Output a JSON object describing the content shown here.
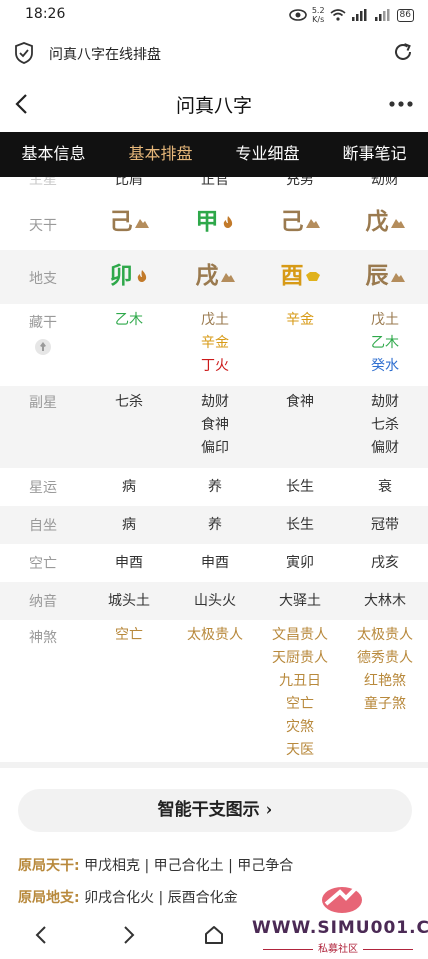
{
  "status": {
    "time": "18:26",
    "netspeed_value": "5.2",
    "netspeed_unit": "K/s",
    "battery": "86"
  },
  "browser": {
    "page_title": "问真八字在线排盘"
  },
  "app": {
    "title": "问真八字"
  },
  "tabs": [
    {
      "label": "基本信息",
      "active": false
    },
    {
      "label": "基本排盘",
      "active": true
    },
    {
      "label": "专业细盘",
      "active": false
    },
    {
      "label": "断事笔记",
      "active": false
    }
  ],
  "chart": {
    "main_star": {
      "label": "主星",
      "values": [
        "比肩",
        "正官",
        "充男",
        "劫财"
      ]
    },
    "heavenly_stems": {
      "label": "天干",
      "values": [
        "己",
        "甲",
        "己",
        "戊"
      ]
    },
    "earthly_branches": {
      "label": "地支",
      "values": [
        "卯",
        "戌",
        "酉",
        "辰"
      ]
    },
    "hidden_stems": {
      "label": "藏干",
      "values": [
        [
          "乙木"
        ],
        [
          "戊土",
          "辛金",
          "丁火"
        ],
        [
          "辛金"
        ],
        [
          "戊土",
          "乙木",
          "癸水"
        ]
      ]
    },
    "sub_star": {
      "label": "副星",
      "values": [
        [
          "七杀"
        ],
        [
          "劫财",
          "食神",
          "偏印"
        ],
        [
          "食神"
        ],
        [
          "劫财",
          "七杀",
          "偏财"
        ]
      ]
    },
    "star_luck": {
      "label": "星运",
      "values": [
        "病",
        "养",
        "长生",
        "衰"
      ]
    },
    "self_seat": {
      "label": "自坐",
      "values": [
        "病",
        "养",
        "长生",
        "冠带"
      ]
    },
    "void": {
      "label": "空亡",
      "values": [
        "申酉",
        "申酉",
        "寅卯",
        "戌亥"
      ]
    },
    "nayin": {
      "label": "纳音",
      "values": [
        "城头土",
        "山头火",
        "大驿土",
        "大林木"
      ]
    },
    "shensha": {
      "label": "神煞",
      "values": [
        [
          "空亡"
        ],
        [
          "太极贵人"
        ],
        [
          "文昌贵人",
          "天厨贵人",
          "九丑日",
          "空亡",
          "灾煞",
          "天医"
        ],
        [
          "太极贵人",
          "德秀贵人",
          "红艳煞",
          "童子煞"
        ]
      ]
    }
  },
  "smart_button": {
    "label": "智能干支图示",
    "chevron": "›"
  },
  "yuanju": {
    "tiangan_label": "原局天干:",
    "tiangan_text": "甲戊相克 | 甲己合化土 | 甲己争合",
    "dizhi_label": "原局地支:",
    "dizhi_text": "卯戌合化火 | 辰酉合化金"
  },
  "watermark": {
    "site": "WWW.SIMU001.CN",
    "sub": "私募社区"
  },
  "colors": {
    "tab_bg": "#111111",
    "tab_active": "#e6b77a",
    "earth": "#9a7a4f",
    "wood": "#2ea84a",
    "metal": "#d79a16",
    "fire": "#cc1a1a",
    "water": "#2f6fd0",
    "gold": "#b8893c"
  }
}
